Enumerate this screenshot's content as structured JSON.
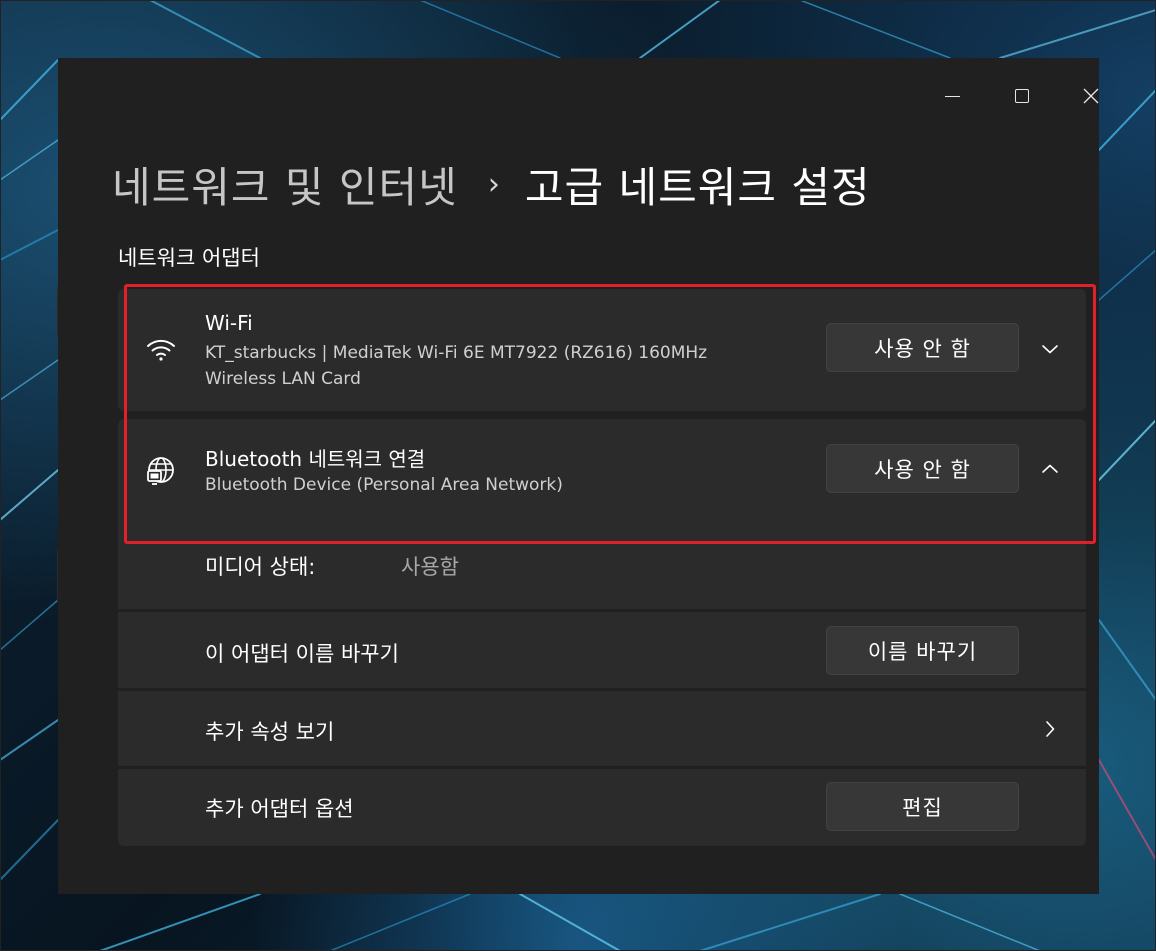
{
  "window": {
    "caption": {
      "minimize_icon": "minimize-icon",
      "maximize_icon": "maximize-icon",
      "close_icon": "close-icon"
    }
  },
  "breadcrumb": {
    "parent": "네트워크 및 인터넷",
    "separator": "›",
    "current": "고급 네트워크 설정"
  },
  "section_title": "네트워크 어댑터",
  "adapters": [
    {
      "icon": "wifi-icon",
      "name": "Wi-Fi",
      "desc_line1": "KT_starbucks | MediaTek Wi-Fi 6E MT7922 (RZ616) 160MHz",
      "desc_line2": "Wireless LAN Card",
      "button": "사용 안 함",
      "expanded": false
    },
    {
      "icon": "globe-network-icon",
      "name": "Bluetooth 네트워크 연결",
      "desc_line1": "Bluetooth Device (Personal Area Network)",
      "button": "사용 안 함",
      "expanded": true
    }
  ],
  "details": {
    "media_state_label": "미디어 상태:",
    "media_state_value": "사용함",
    "rename_label": "이 어댑터 이름 바꾸기",
    "rename_button": "이름 바꾸기",
    "more_props_label": "추가 속성 보기",
    "more_options_label": "추가 어댑터 옵션",
    "edit_button": "편집"
  },
  "colors": {
    "window_bg": "#202020",
    "card_bg": "#2b2b2b",
    "button_bg": "#373737",
    "highlight": "#e0202a"
  }
}
